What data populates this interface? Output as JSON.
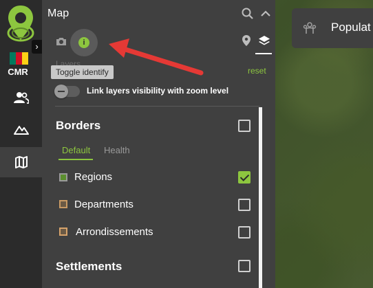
{
  "rail": {
    "country_code": "CMR",
    "expand_glyph": "›",
    "items": [
      {
        "name": "people-icon"
      },
      {
        "name": "mountain-icon"
      },
      {
        "name": "map-icon",
        "active": true
      }
    ],
    "flag_colors": [
      "#007a5e",
      "#ce1126",
      "#fcd116"
    ]
  },
  "panel": {
    "title": "Map",
    "tooltip": "Toggle identify",
    "layers_label": "Layers",
    "reset_label": "reset",
    "link_visibility_label": "Link layers visibility with zoom level",
    "identify_glyph": "i"
  },
  "sections": {
    "borders": {
      "title": "Borders",
      "tabs": [
        "Default",
        "Health"
      ],
      "layers": [
        {
          "label": "Regions",
          "checked": true
        },
        {
          "label": "Departments",
          "checked": false
        },
        {
          "label": "Arrondissements",
          "checked": false
        }
      ]
    },
    "settlements": {
      "title": "Settlements"
    }
  },
  "card": {
    "label": "Populat"
  },
  "colors": {
    "accent": "#8dc63f",
    "panel": "#404040",
    "rail": "#2b2b2b",
    "arrow": "#e53935"
  }
}
